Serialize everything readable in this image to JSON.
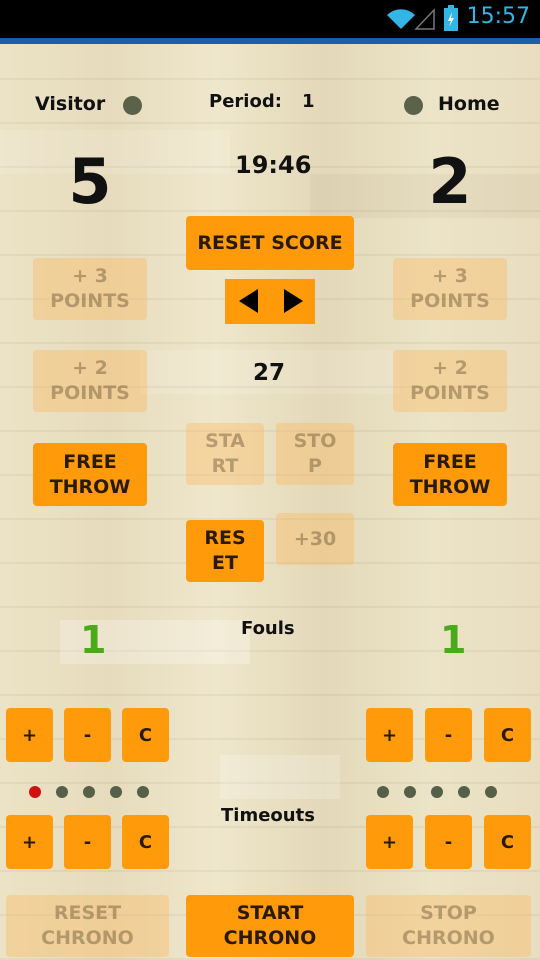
{
  "status_bar": {
    "time": "15:57",
    "icons": [
      "wifi-icon",
      "signal-icon",
      "battery-charging-icon"
    ]
  },
  "header": {
    "visitor_label": "Visitor",
    "home_label": "Home",
    "period_label": "Period:",
    "period_value": "1"
  },
  "clock": {
    "game_time": "19:46",
    "shot_clock": "27"
  },
  "scores": {
    "visitor": "5",
    "home": "2"
  },
  "buttons": {
    "reset_score": "RESET SCORE",
    "plus3": [
      "+ 3",
      "POINTS"
    ],
    "plus2": [
      "+ 2",
      "POINTS"
    ],
    "free_throw": [
      "FREE",
      "THROW"
    ],
    "start": [
      "STA",
      "RT"
    ],
    "stop": [
      "STO",
      "P"
    ],
    "reset": [
      "RES",
      "ET"
    ],
    "plus30": "+30",
    "plus": "+",
    "minus": "-",
    "clear": "C",
    "reset_chrono": [
      "RESET",
      "CHRONO"
    ],
    "start_chrono": [
      "START",
      "CHRONO"
    ],
    "stop_chrono": [
      "STOP",
      "CHRONO"
    ]
  },
  "fouls": {
    "label": "Fouls",
    "visitor": "1",
    "home": "1"
  },
  "timeouts": {
    "label": "Timeouts",
    "visitor_used": 1,
    "home_used": 0,
    "max": 5
  },
  "colors": {
    "accent": "#ff9b0b",
    "foul_count": "#4aaa1a",
    "timeout_used": "#d01010",
    "timeout_free": "#556048"
  }
}
